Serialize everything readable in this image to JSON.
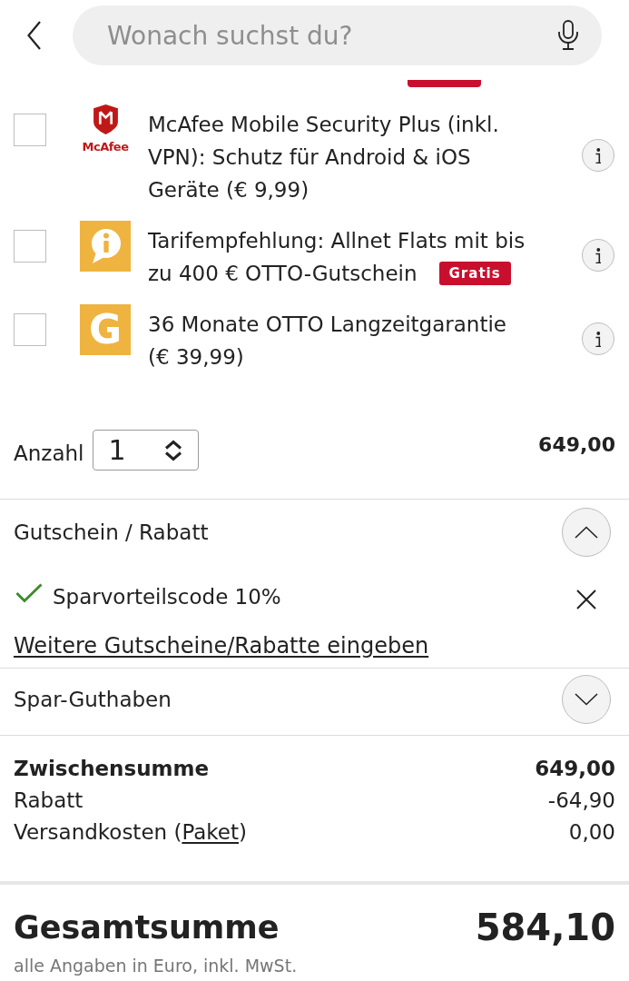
{
  "header": {
    "search": {
      "placeholder": "Wonach suchst du?"
    }
  },
  "addons": [
    {
      "logo": {
        "kind": "shield",
        "text": "McAfee"
      },
      "label": "McAfee Mobile Security Plus (inkl. VPN): Schutz für Android & iOS Geräte (€ 9,99)",
      "checked": false
    },
    {
      "logo": {
        "kind": "speech"
      },
      "label": "Tarifempfehlung: Allnet Flats mit bis zu 400 € OTTO-Gutschein",
      "badge": "Gratis",
      "checked": false
    },
    {
      "logo": {
        "kind": "letter",
        "text": "G"
      },
      "label": "36 Monate OTTO Langzeitgarantie (€ 39,99)",
      "checked": false
    }
  ],
  "quantity": {
    "label": "Anzahl",
    "value": "1",
    "price": "649,00"
  },
  "sections": [
    {
      "title": "Gutschein / Rabatt",
      "expanded": true,
      "applied_codes": [
        {
          "label": "Sparvorteilscode 10%"
        }
      ],
      "link": "Weitere Gutscheine/Rabatte eingeben"
    },
    {
      "title": "Spar-Guthaben",
      "expanded": false
    }
  ],
  "summary": [
    {
      "label": "Zwischensumme",
      "value": "649,00",
      "bold": true
    },
    {
      "label": "Rabatt",
      "value": "-64,90",
      "bold": false
    },
    {
      "label": "Versandkosten (",
      "link": "Paket",
      "label_after": ")",
      "value": "0,00",
      "bold": false
    }
  ],
  "total": {
    "label": "Gesamtsumme",
    "value": "584,10",
    "note": "alle Angaben in Euro, inkl. MwSt."
  }
}
